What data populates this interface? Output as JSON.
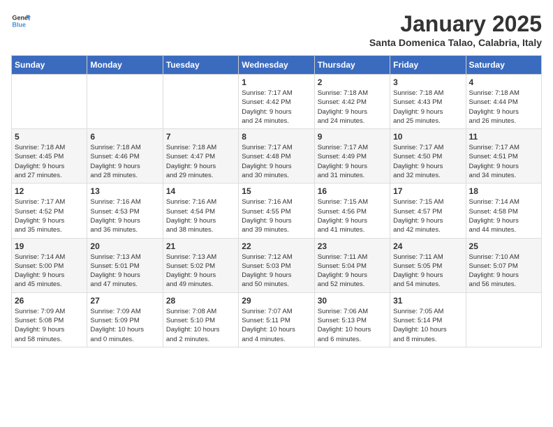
{
  "logo": {
    "text_general": "General",
    "text_blue": "Blue"
  },
  "title": "January 2025",
  "subtitle": "Santa Domenica Talao, Calabria, Italy",
  "weekdays": [
    "Sunday",
    "Monday",
    "Tuesday",
    "Wednesday",
    "Thursday",
    "Friday",
    "Saturday"
  ],
  "weeks": [
    [
      {
        "day": "",
        "info": ""
      },
      {
        "day": "",
        "info": ""
      },
      {
        "day": "",
        "info": ""
      },
      {
        "day": "1",
        "info": "Sunrise: 7:17 AM\nSunset: 4:42 PM\nDaylight: 9 hours\nand 24 minutes."
      },
      {
        "day": "2",
        "info": "Sunrise: 7:18 AM\nSunset: 4:42 PM\nDaylight: 9 hours\nand 24 minutes."
      },
      {
        "day": "3",
        "info": "Sunrise: 7:18 AM\nSunset: 4:43 PM\nDaylight: 9 hours\nand 25 minutes."
      },
      {
        "day": "4",
        "info": "Sunrise: 7:18 AM\nSunset: 4:44 PM\nDaylight: 9 hours\nand 26 minutes."
      }
    ],
    [
      {
        "day": "5",
        "info": "Sunrise: 7:18 AM\nSunset: 4:45 PM\nDaylight: 9 hours\nand 27 minutes."
      },
      {
        "day": "6",
        "info": "Sunrise: 7:18 AM\nSunset: 4:46 PM\nDaylight: 9 hours\nand 28 minutes."
      },
      {
        "day": "7",
        "info": "Sunrise: 7:18 AM\nSunset: 4:47 PM\nDaylight: 9 hours\nand 29 minutes."
      },
      {
        "day": "8",
        "info": "Sunrise: 7:17 AM\nSunset: 4:48 PM\nDaylight: 9 hours\nand 30 minutes."
      },
      {
        "day": "9",
        "info": "Sunrise: 7:17 AM\nSunset: 4:49 PM\nDaylight: 9 hours\nand 31 minutes."
      },
      {
        "day": "10",
        "info": "Sunrise: 7:17 AM\nSunset: 4:50 PM\nDaylight: 9 hours\nand 32 minutes."
      },
      {
        "day": "11",
        "info": "Sunrise: 7:17 AM\nSunset: 4:51 PM\nDaylight: 9 hours\nand 34 minutes."
      }
    ],
    [
      {
        "day": "12",
        "info": "Sunrise: 7:17 AM\nSunset: 4:52 PM\nDaylight: 9 hours\nand 35 minutes."
      },
      {
        "day": "13",
        "info": "Sunrise: 7:16 AM\nSunset: 4:53 PM\nDaylight: 9 hours\nand 36 minutes."
      },
      {
        "day": "14",
        "info": "Sunrise: 7:16 AM\nSunset: 4:54 PM\nDaylight: 9 hours\nand 38 minutes."
      },
      {
        "day": "15",
        "info": "Sunrise: 7:16 AM\nSunset: 4:55 PM\nDaylight: 9 hours\nand 39 minutes."
      },
      {
        "day": "16",
        "info": "Sunrise: 7:15 AM\nSunset: 4:56 PM\nDaylight: 9 hours\nand 41 minutes."
      },
      {
        "day": "17",
        "info": "Sunrise: 7:15 AM\nSunset: 4:57 PM\nDaylight: 9 hours\nand 42 minutes."
      },
      {
        "day": "18",
        "info": "Sunrise: 7:14 AM\nSunset: 4:58 PM\nDaylight: 9 hours\nand 44 minutes."
      }
    ],
    [
      {
        "day": "19",
        "info": "Sunrise: 7:14 AM\nSunset: 5:00 PM\nDaylight: 9 hours\nand 45 minutes."
      },
      {
        "day": "20",
        "info": "Sunrise: 7:13 AM\nSunset: 5:01 PM\nDaylight: 9 hours\nand 47 minutes."
      },
      {
        "day": "21",
        "info": "Sunrise: 7:13 AM\nSunset: 5:02 PM\nDaylight: 9 hours\nand 49 minutes."
      },
      {
        "day": "22",
        "info": "Sunrise: 7:12 AM\nSunset: 5:03 PM\nDaylight: 9 hours\nand 50 minutes."
      },
      {
        "day": "23",
        "info": "Sunrise: 7:11 AM\nSunset: 5:04 PM\nDaylight: 9 hours\nand 52 minutes."
      },
      {
        "day": "24",
        "info": "Sunrise: 7:11 AM\nSunset: 5:05 PM\nDaylight: 9 hours\nand 54 minutes."
      },
      {
        "day": "25",
        "info": "Sunrise: 7:10 AM\nSunset: 5:07 PM\nDaylight: 9 hours\nand 56 minutes."
      }
    ],
    [
      {
        "day": "26",
        "info": "Sunrise: 7:09 AM\nSunset: 5:08 PM\nDaylight: 9 hours\nand 58 minutes."
      },
      {
        "day": "27",
        "info": "Sunrise: 7:09 AM\nSunset: 5:09 PM\nDaylight: 10 hours\nand 0 minutes."
      },
      {
        "day": "28",
        "info": "Sunrise: 7:08 AM\nSunset: 5:10 PM\nDaylight: 10 hours\nand 2 minutes."
      },
      {
        "day": "29",
        "info": "Sunrise: 7:07 AM\nSunset: 5:11 PM\nDaylight: 10 hours\nand 4 minutes."
      },
      {
        "day": "30",
        "info": "Sunrise: 7:06 AM\nSunset: 5:13 PM\nDaylight: 10 hours\nand 6 minutes."
      },
      {
        "day": "31",
        "info": "Sunrise: 7:05 AM\nSunset: 5:14 PM\nDaylight: 10 hours\nand 8 minutes."
      },
      {
        "day": "",
        "info": ""
      }
    ]
  ]
}
